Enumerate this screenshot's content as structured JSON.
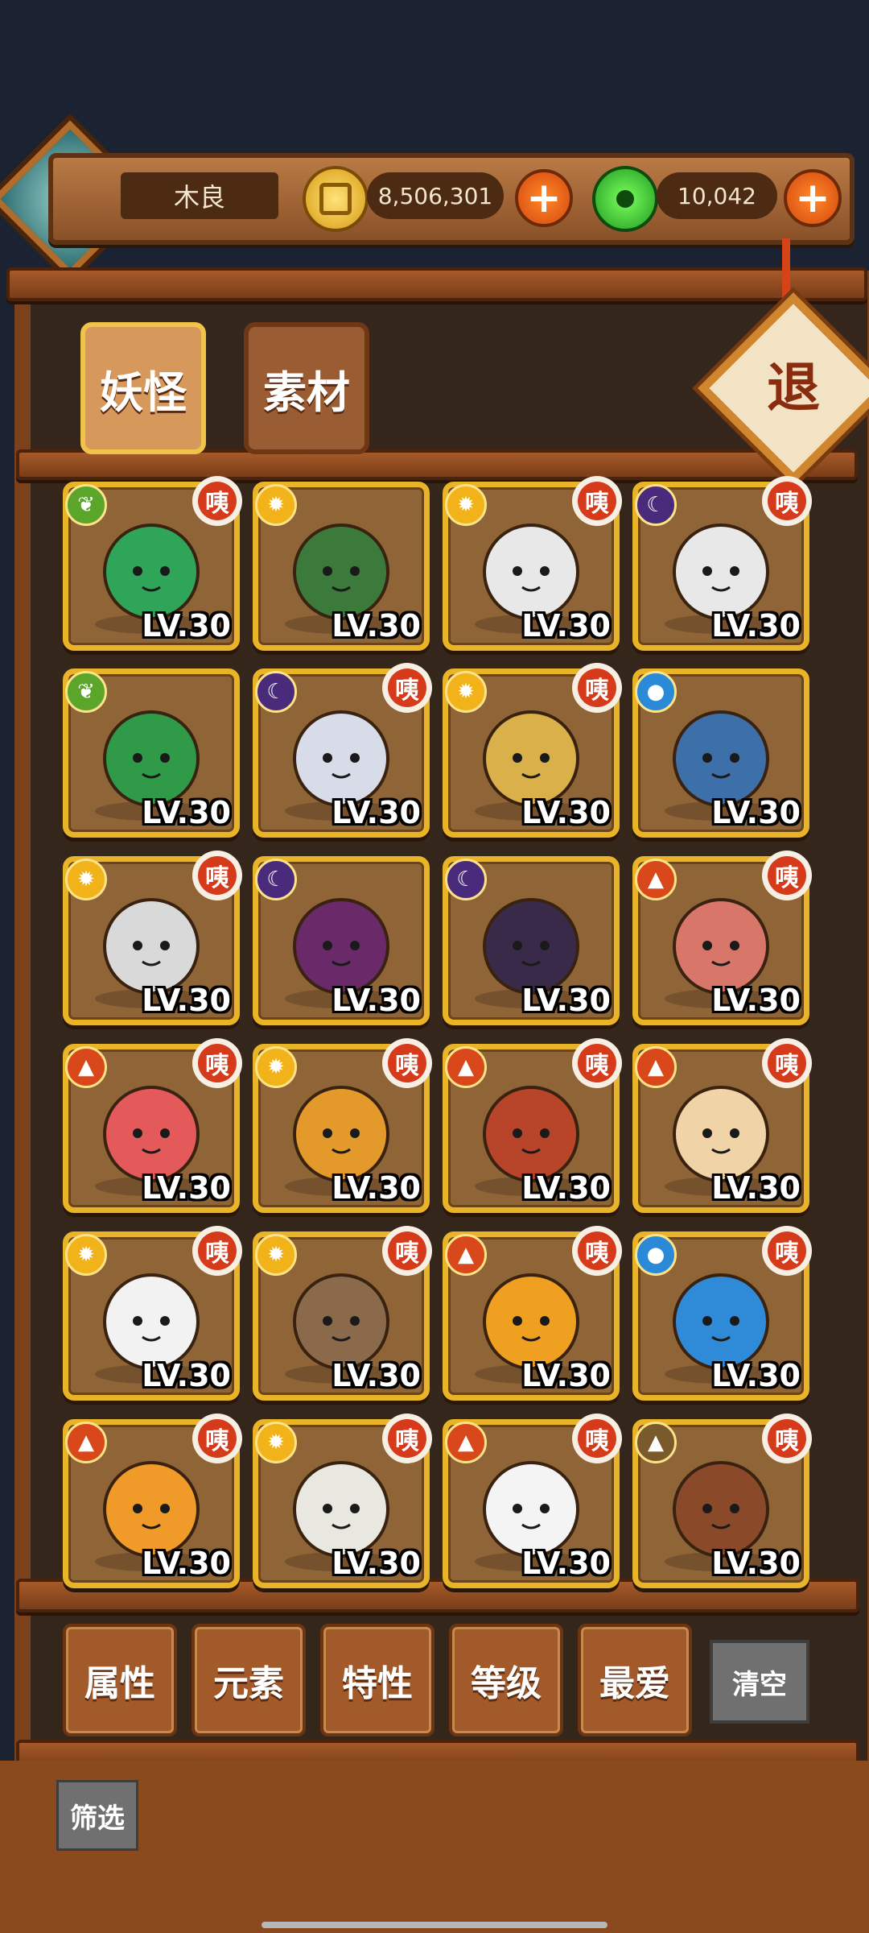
{
  "header": {
    "player_name": "木良",
    "coins": "8,506,301",
    "jade": "10,042",
    "plus_label": "+"
  },
  "tabs": [
    {
      "label": "妖怪",
      "selected": true
    },
    {
      "label": "素材",
      "selected": false
    }
  ],
  "exit_label": "退",
  "colors": {
    "card_border": "#e9b428",
    "card_bg": "#8f6537",
    "badge_red": "#d53a1a",
    "wood": "#7b401c"
  },
  "cards": [
    {
      "element": "leaf",
      "badge": "咦",
      "art": "green-jade-pendant",
      "level": "LV.30"
    },
    {
      "element": "sun",
      "badge": "",
      "art": "green-haired-flute-player",
      "level": "LV.30"
    },
    {
      "element": "sun",
      "badge": "咦",
      "art": "mahjong-tile-blue",
      "level": "LV.30"
    },
    {
      "element": "moon",
      "badge": "咦",
      "art": "mahjong-tile-red",
      "level": "LV.30"
    },
    {
      "element": "leaf",
      "badge": "",
      "art": "snake-haired-girl",
      "level": "LV.30"
    },
    {
      "element": "moon",
      "badge": "咦",
      "art": "white-ghost-blob",
      "level": "LV.30"
    },
    {
      "element": "sun",
      "badge": "咦",
      "art": "golden-horn-spirit",
      "level": "LV.30"
    },
    {
      "element": "water",
      "badge": "",
      "art": "blue-haired-maiden",
      "level": "LV.30"
    },
    {
      "element": "sun",
      "badge": "咦",
      "art": "silver-haired-monk",
      "level": "LV.30"
    },
    {
      "element": "moon",
      "badge": "",
      "art": "crowned-queen",
      "level": "LV.30"
    },
    {
      "element": "moon",
      "badge": "",
      "art": "dark-robed-scholar",
      "level": "LV.30"
    },
    {
      "element": "fire",
      "badge": "咦",
      "art": "red-hook-spirit",
      "level": "LV.30"
    },
    {
      "element": "fire",
      "badge": "咦",
      "art": "red-heart",
      "level": "LV.30"
    },
    {
      "element": "sun",
      "badge": "咦",
      "art": "amber-stone",
      "level": "LV.30"
    },
    {
      "element": "fire",
      "badge": "咦",
      "art": "red-orb-on-stand",
      "level": "LV.30"
    },
    {
      "element": "fire",
      "badge": "咦",
      "art": "bone-spirit",
      "level": "LV.30"
    },
    {
      "element": "sun",
      "badge": "咦",
      "art": "white-fox",
      "level": "LV.30"
    },
    {
      "element": "sun",
      "badge": "咦",
      "art": "paper-cup-spirit",
      "level": "LV.30"
    },
    {
      "element": "fire",
      "badge": "咦",
      "art": "orange-fire-blob",
      "level": "LV.30"
    },
    {
      "element": "water",
      "badge": "咦",
      "art": "blue-water-blob",
      "level": "LV.30"
    },
    {
      "element": "fire",
      "badge": "咦",
      "art": "goldfish",
      "level": "LV.30"
    },
    {
      "element": "sun",
      "badge": "咦",
      "art": "white-ram",
      "level": "LV.30"
    },
    {
      "element": "fire",
      "badge": "咦",
      "art": "white-wild-cat",
      "level": "LV.30"
    },
    {
      "element": "earth",
      "badge": "咦",
      "art": "brown-hat-critter",
      "level": "LV.30"
    }
  ],
  "filters": [
    {
      "label": "属性"
    },
    {
      "label": "元素"
    },
    {
      "label": "特性"
    },
    {
      "label": "等级"
    },
    {
      "label": "最爱"
    }
  ],
  "clear_label": "清空",
  "filter_tab_label": "筛选"
}
